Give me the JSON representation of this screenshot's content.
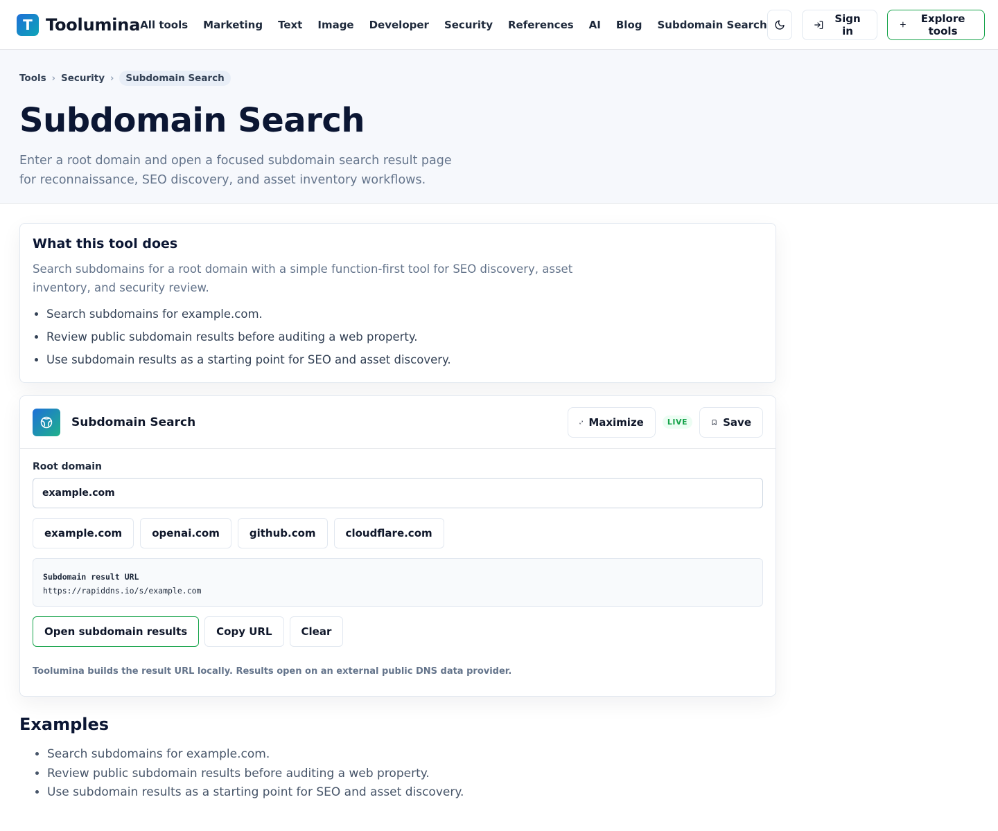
{
  "brand": {
    "logo_letter": "T",
    "name": "Toolumina"
  },
  "nav": [
    "All tools",
    "Marketing",
    "Text",
    "Image",
    "Developer",
    "Security",
    "References",
    "AI",
    "Blog",
    "Subdomain Search"
  ],
  "top_actions": {
    "theme_icon": "moon-icon",
    "sign_in": "Sign in",
    "explore": "Explore tools"
  },
  "breadcrumb": {
    "items": [
      "Tools",
      "Security"
    ],
    "current": "Subdomain Search"
  },
  "hero": {
    "title": "Subdomain Search",
    "description": "Enter a root domain and open a focused subdomain search result page for reconnaissance, SEO discovery, and asset inventory workflows."
  },
  "about": {
    "heading": "What this tool does",
    "text": "Search subdomains for a root domain with a simple function-first tool for SEO discovery, asset inventory, and security review.",
    "bullets": [
      "Search subdomains for example.com.",
      "Review public subdomain results before auditing a web property.",
      "Use subdomain results as a starting point for SEO and asset discovery."
    ]
  },
  "tool": {
    "name": "Subdomain Search",
    "maximize": "Maximize",
    "live_badge": "LIVE",
    "save": "Save",
    "field_label": "Root domain",
    "input_value": "example.com",
    "presets": [
      "example.com",
      "openai.com",
      "github.com",
      "cloudflare.com"
    ],
    "result_label": "Subdomain result URL",
    "result_url": "https://rapiddns.io/s/example.com",
    "open_button": "Open subdomain results",
    "copy_button": "Copy URL",
    "clear_button": "Clear",
    "note": "Toolumina builds the result URL locally. Results open on an external public DNS data provider."
  },
  "examples": {
    "heading": "Examples",
    "items": [
      "Search subdomains for example.com.",
      "Review public subdomain results before auditing a web property.",
      "Use subdomain results as a starting point for SEO and asset discovery."
    ]
  },
  "colors": {
    "accent": "#16a34a",
    "brand_gradient_start": "#1f6fd8",
    "brand_gradient_end": "#0ea5b7",
    "hero_bg": "#f6f8fc"
  }
}
